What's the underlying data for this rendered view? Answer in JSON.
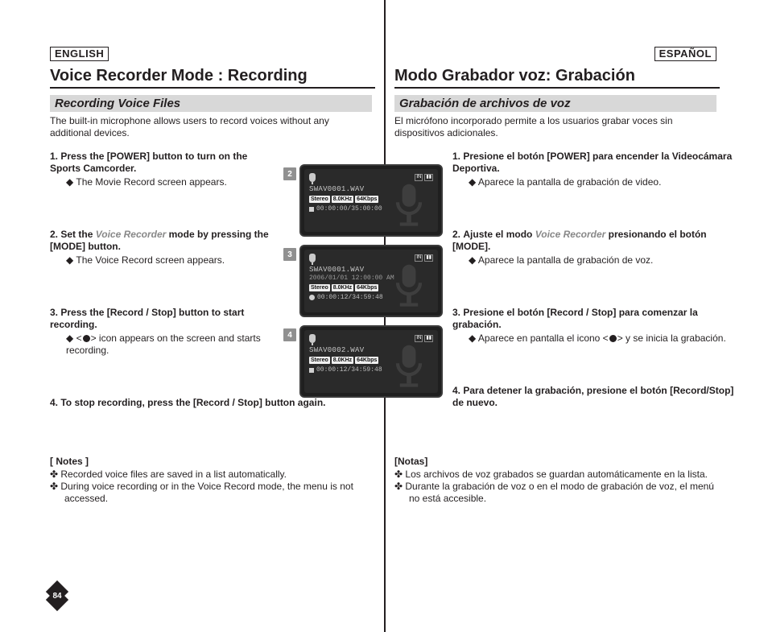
{
  "page_number": "84",
  "left": {
    "lang": "ENGLISH",
    "title": "Voice Recorder Mode : Recording",
    "section": "Recording Voice Files",
    "intro": "The built-in microphone allows users to record voices without any additional devices.",
    "steps": [
      {
        "num": "1.",
        "head": "Press the [POWER] button to turn on the Sports Camcorder.",
        "sub": "The Movie Record screen appears."
      },
      {
        "num": "2.",
        "head_a": "Set the ",
        "mode": "Voice Recorder",
        "head_b": " mode by pressing the [MODE] button.",
        "sub": "The Voice Record screen appears."
      },
      {
        "num": "3.",
        "head": "Press the [Record / Stop] button to start recording.",
        "sub_pre": "<",
        "sub_post": "> icon appears on the screen and starts recording."
      },
      {
        "num": "4.",
        "head": "To stop recording, press the [Record / Stop] button again."
      }
    ],
    "notes_h": "[ Notes ]",
    "notes": [
      "Recorded voice files are saved in a list automatically.",
      "During voice recording or in the Voice Record mode, the menu is not accessed."
    ]
  },
  "right": {
    "lang": "ESPAÑOL",
    "title": "Modo Grabador voz: Grabación",
    "section": "Grabación de archivos de voz",
    "intro": "El micrófono incorporado permite a los usuarios grabar voces sin dispositivos adicionales.",
    "steps": [
      {
        "num": "1.",
        "head": "Presione el botón [POWER] para encender la Videocámara Deportiva.",
        "sub": "Aparece la pantalla de grabación de video."
      },
      {
        "num": "2.",
        "head_a": "Ajuste el modo ",
        "mode": "Voice Recorder",
        "head_b": " presionando el botón [MODE].",
        "sub": "Aparece la pantalla de grabación de voz."
      },
      {
        "num": "3.",
        "head": "Presione el botón [Record / Stop] para comenzar la grabación.",
        "sub_pre": "Aparece en pantalla el icono <",
        "sub_post": "> y se inicia la grabación."
      },
      {
        "num": "4.",
        "head": "Para detener la grabación, presione el botón [Record/Stop] de nuevo."
      }
    ],
    "notes_h": "[Notas]",
    "notes": [
      "Los archivos de voz grabados se guardan automáticamente en la lista.",
      "Durante la grabación de voz o en el modo de grabación de voz, el menú no está accesible."
    ]
  },
  "screens": [
    {
      "chip": "2",
      "file": "SWAV0001.WAV",
      "date": "",
      "tags": [
        "Stereo",
        "8.0KHz",
        "64Kbps"
      ],
      "time": "00:00:00/35:00:00",
      "state": "stop"
    },
    {
      "chip": "3",
      "file": "SWAV0001.WAV",
      "date": "2006/01/01 12:00:00 AM",
      "tags": [
        "Stereo",
        "8.0KHz",
        "64Kbps"
      ],
      "time": "00:00:12/34:59:48",
      "state": "rec"
    },
    {
      "chip": "4",
      "file": "SWAV0002.WAV",
      "date": "",
      "tags": [
        "Stereo",
        "8.0KHz",
        "64Kbps"
      ],
      "time": "00:00:12/34:59:48",
      "state": "stop"
    }
  ],
  "indicator_labels": [
    "IN",
    "▮▮"
  ]
}
